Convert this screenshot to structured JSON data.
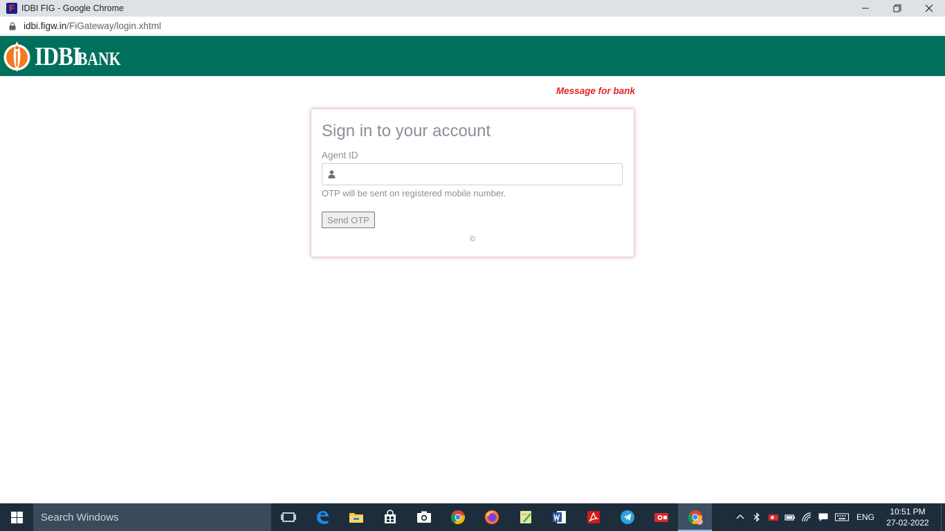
{
  "window": {
    "title": "IDBI FIG - Google Chrome"
  },
  "address": {
    "domain": "idbi.figw.in",
    "path": "/FiGateway/login.xhtml"
  },
  "header": {
    "logo_primary": "IDBI",
    "logo_secondary": "BANK"
  },
  "message_link": "Message for bank",
  "login": {
    "title": "Sign in to your account",
    "agent_label": "Agent ID",
    "agent_value": "",
    "otp_note": "OTP will be sent on registered mobile number.",
    "send_button": "Send OTP",
    "copyright": "©"
  },
  "taskbar": {
    "search_placeholder": "Search Windows",
    "apps": [
      "task-view",
      "edge",
      "file-explorer",
      "store",
      "camera",
      "chrome",
      "firefox",
      "notepad",
      "word",
      "acrobat",
      "telegram",
      "recorder",
      "chrome-profile"
    ],
    "language": "ENG",
    "time": "10:51 PM",
    "date": "27-02-2022"
  },
  "colors": {
    "bank_green": "#00705c",
    "message_red": "#e0252a",
    "logo_orange": "#f47920",
    "taskbar": "#1e2d3b"
  }
}
